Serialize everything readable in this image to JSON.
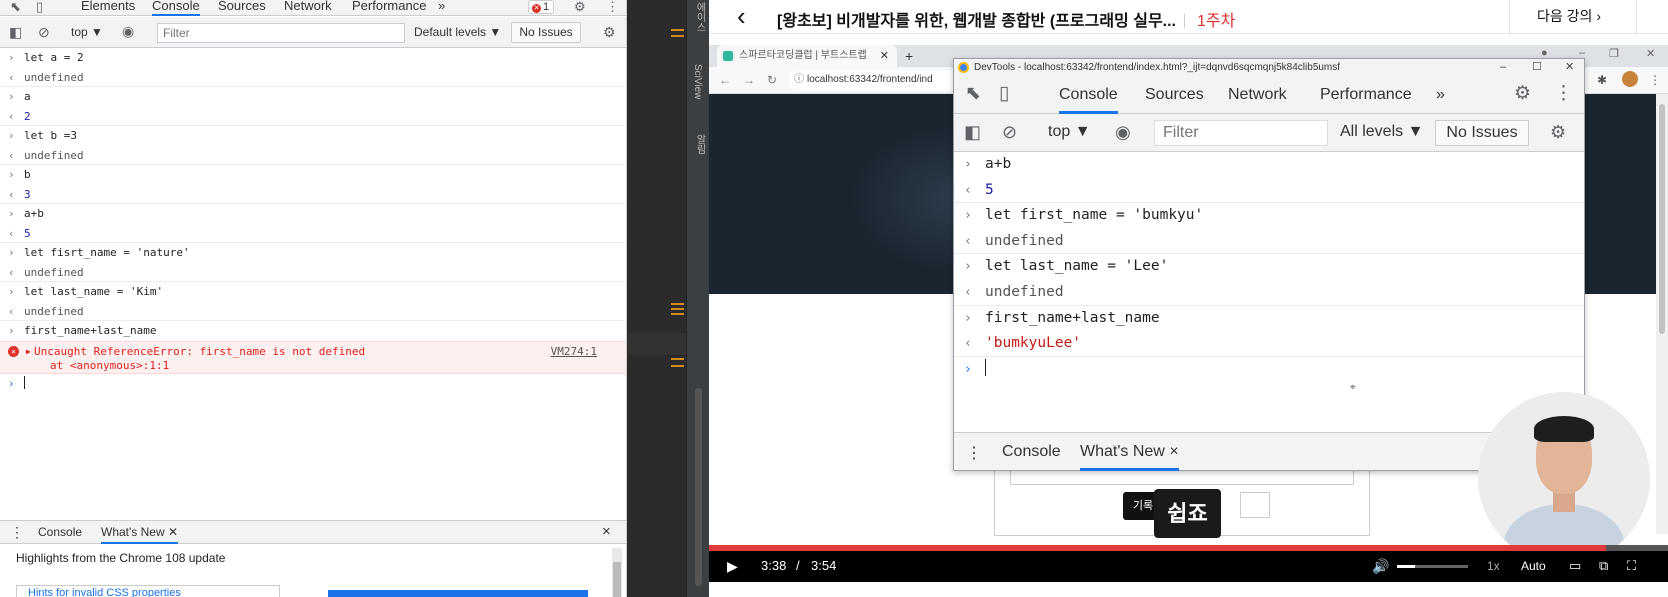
{
  "left_devtools": {
    "tabs": [
      "Elements",
      "Console",
      "Sources",
      "Network",
      "Performance"
    ],
    "more_tabs": "»",
    "error_count": "1",
    "toolbar": {
      "context": "top ▼",
      "filter_placeholder": "Filter",
      "levels": "Default levels ▼",
      "issues": "No Issues"
    },
    "console_rows": [
      {
        "type": "in",
        "text": "let a = 2"
      },
      {
        "type": "out",
        "text": "undefined"
      },
      {
        "type": "in",
        "text": "a"
      },
      {
        "type": "out",
        "text": "2"
      },
      {
        "type": "in",
        "text": "let b =3"
      },
      {
        "type": "out",
        "text": "undefined"
      },
      {
        "type": "in",
        "text": "b"
      },
      {
        "type": "out",
        "text": "3"
      },
      {
        "type": "in",
        "text": "a+b"
      },
      {
        "type": "out",
        "text": "5"
      },
      {
        "type": "in",
        "text": "let fisrt_name = 'nature'"
      },
      {
        "type": "out",
        "text": "undefined"
      },
      {
        "type": "in",
        "text": "let last_name = 'Kim'"
      },
      {
        "type": "out",
        "text": "undefined"
      },
      {
        "type": "in",
        "text": "first_name+last_name"
      }
    ],
    "error": {
      "line1": "Uncaught ReferenceError: first_name is not defined",
      "line2": "at <anonymous>:1:1",
      "link": "VM274:1"
    },
    "drawer": {
      "tabs": [
        "Console",
        "What's New"
      ],
      "close": "×",
      "highlights": "Highlights from the Chrome 108 update",
      "card_text": "Hints for invalid CSS properties"
    }
  },
  "mid_panel": {
    "vertical_labels": [
      "에이스",
      "SciView",
      "알림"
    ]
  },
  "video": {
    "header": {
      "title": "[왕초보] 비개발자를 위한, 웹개발 종합반 (프로그래밍 실무...",
      "week": "1주차",
      "next": "다음 강의"
    },
    "browser": {
      "tab_title": "스파르타코딩클럽 | 부트스트랩",
      "url": "localhost:63342/frontend/ind"
    },
    "devtools": {
      "window_title": "DevTools - localhost:63342/frontend/index.html?_ijt=dqnvd6sqcmqnj5k84clib5umsf",
      "tabs": [
        "Console",
        "Sources",
        "Network",
        "Performance"
      ],
      "more_tabs": "»",
      "toolbar": {
        "context": "top ▼",
        "filter_placeholder": "Filter",
        "levels": "All levels ▼",
        "issues": "No Issues"
      },
      "console_rows": [
        {
          "type": "in",
          "text": "a+b"
        },
        {
          "type": "out",
          "text": "5"
        },
        {
          "type": "in",
          "text": "let first_name = 'bumkyu'"
        },
        {
          "type": "out",
          "text": "undefined"
        },
        {
          "type": "in",
          "text": "let last_name = 'Lee'"
        },
        {
          "type": "out",
          "text": "undefined"
        },
        {
          "type": "in",
          "text": "first_name+last_name"
        },
        {
          "type": "out",
          "text": "'bumkyuLee'"
        }
      ],
      "drawer_tabs": [
        "Console",
        "What's New"
      ],
      "drawer_close": "×"
    },
    "overlay": {
      "small_tooltip": "기록",
      "subtitle": "쉽죠"
    },
    "player": {
      "current_time": "3:38",
      "separator": "/",
      "duration": "3:54",
      "progress": 0.935,
      "volume": 0.25,
      "speed": "1x",
      "quality": "Auto"
    }
  }
}
